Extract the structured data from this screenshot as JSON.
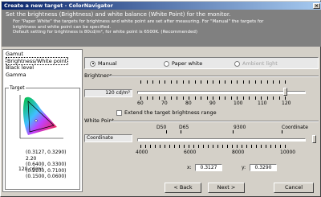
{
  "window": {
    "title": "Create a new target - ColorNavigator"
  },
  "header": {
    "heading": "Set the brightness (Brightness) and white balance (White Point) for the monitor.",
    "line1": "For \"Paper White\" the targets for brightness and white point are set after measuring. For \"Manual\" the targets for",
    "line2": "brightness and white point can be specified.",
    "line3": "Default setting for brightness is 80cd/m², for white point is 6500K. (Recommended)"
  },
  "sidebar": {
    "items": [
      {
        "label": "Gamut"
      },
      {
        "label": "Brightness/White point"
      },
      {
        "label": "Black level"
      },
      {
        "label": "Gamma"
      }
    ],
    "target": {
      "legend": "Target",
      "brightness": "120 cd/m²",
      "lines": [
        "(0.3127, 0.3290)",
        "2.20",
        "(0.6400, 0.3300)",
        "(0.2100, 0.7100)",
        "(0.1500, 0.0600)"
      ]
    }
  },
  "mode": {
    "manual": "Manual",
    "paper_white": "Paper white",
    "ambient_light": "Ambient light"
  },
  "brightness": {
    "title": "Brightness",
    "value": "120 cd/m²",
    "value_num": 120,
    "ticks": [
      "60",
      "70",
      "80",
      "90",
      "100",
      "110",
      "120"
    ],
    "range": [
      60,
      120
    ],
    "extend_label": "Extend the target brightness range"
  },
  "white_point": {
    "title": "White Point",
    "presets": [
      "D50",
      "D65",
      "9300",
      "Coordinate"
    ],
    "mode_field": "Coordinate",
    "ticks": [
      "4000",
      "6000",
      "8000",
      "10000"
    ],
    "x_label": "x:",
    "x_value": "0.3127",
    "y_label": "y:",
    "y_value": "0.3290"
  },
  "buttons": {
    "back": "< Back",
    "next": "Next >",
    "cancel": "Cancel"
  }
}
